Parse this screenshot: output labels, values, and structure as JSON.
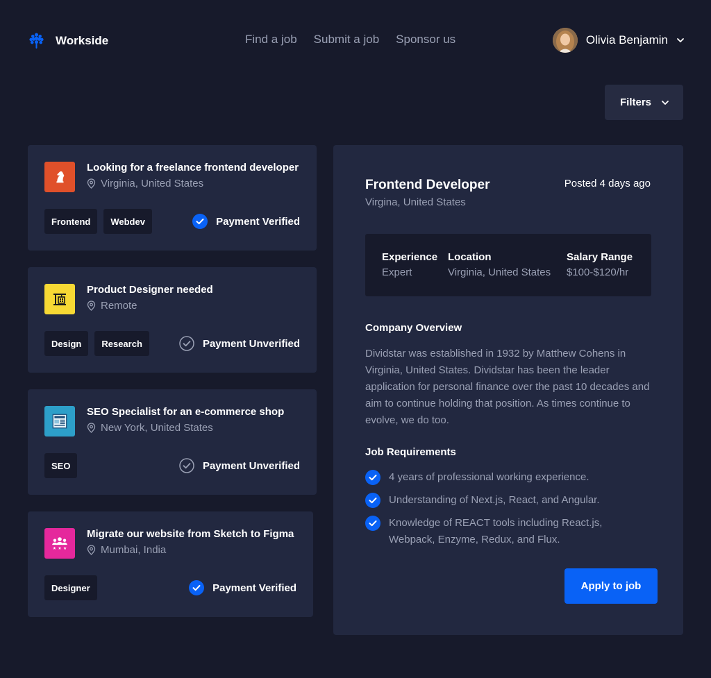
{
  "brand": {
    "name": "Workside",
    "accent": "#0962f6"
  },
  "nav": {
    "items": [
      "Find a job",
      "Submit a job",
      "Sponsor us"
    ]
  },
  "user": {
    "name": "Olivia Benjamin"
  },
  "filters": {
    "label": "Filters"
  },
  "jobs": [
    {
      "title": "Looking for a freelance frontend developer",
      "location": "Virginia, United States",
      "tags": [
        "Frontend",
        "Webdev"
      ],
      "payment": "Payment Verified",
      "verified": true,
      "icon": "chess-knight-icon",
      "icon_color": "#e0502a"
    },
    {
      "title": "Product Designer needed",
      "location": "Remote",
      "tags": [
        "Design",
        "Research"
      ],
      "payment": "Payment Unverified",
      "verified": false,
      "icon": "crane-icon",
      "icon_color": "#f7d934"
    },
    {
      "title": "SEO Specialist for an e-commerce shop",
      "location": "New York, United States",
      "tags": [
        "SEO"
      ],
      "payment": "Payment Unverified",
      "verified": false,
      "icon": "newspaper-icon",
      "icon_color": "#2d9fc9"
    },
    {
      "title": "Migrate our website from Sketch to Figma",
      "location": "Mumbai, India",
      "tags": [
        "Designer"
      ],
      "payment": "Payment Verified",
      "verified": true,
      "icon": "team-icon",
      "icon_color": "#e5289c"
    }
  ],
  "detail": {
    "title": "Frontend Developer",
    "subtitle": "Virgina, United States",
    "posted": "Posted 4 days ago",
    "info": [
      {
        "label": "Experience",
        "value": "Expert"
      },
      {
        "label": "Location",
        "value": "Virginia, United States"
      },
      {
        "label": "Salary Range",
        "value": "$100-$120/hr"
      }
    ],
    "overview_title": "Company Overview",
    "overview": "Dividstar was established in 1932 by Matthew Cohens in Virginia, United States. Dividstar has been the leader application for personal finance over the past 10 decades and aim to continue holding that position. As times continue to evolve, we do too.",
    "requirements_title": "Job Requirements",
    "requirements": [
      "4 years of professional working experience.",
      "Understanding of Next.js, React, and Angular.",
      "Knowledge of REACT tools including React.js, Webpack, Enzyme, Redux, and Flux."
    ],
    "apply_label": "Apply to job"
  }
}
